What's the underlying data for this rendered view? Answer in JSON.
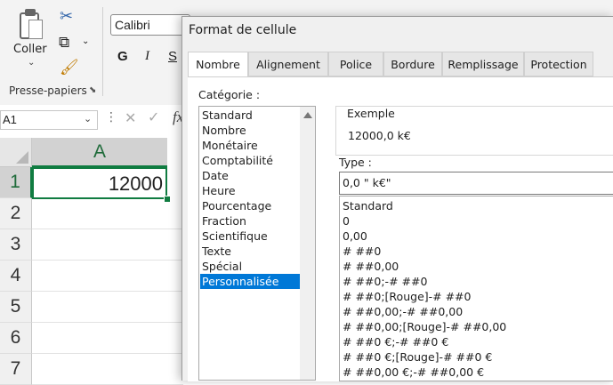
{
  "ribbon": {
    "paste_label": "Coller",
    "clipboard_group_label": "Presse-papiers",
    "font_name": "Calibri",
    "bold_label": "G",
    "italic_label": "I",
    "underline_label": "S"
  },
  "formula_bar": {
    "name_box": "A1",
    "fx_label": "fx"
  },
  "sheet": {
    "column_header": "A",
    "rows": [
      "1",
      "2",
      "3",
      "4",
      "5",
      "6",
      "7"
    ],
    "cell_a1": "12000"
  },
  "dialog": {
    "title": "Format de cellule",
    "tabs": [
      "Nombre",
      "Alignement",
      "Police",
      "Bordure",
      "Remplissage",
      "Protection"
    ],
    "active_tab": "Nombre",
    "category_label": "Catégorie :",
    "categories": [
      "Standard",
      "Nombre",
      "Monétaire",
      "Comptabilité",
      "Date",
      "Heure",
      "Pourcentage",
      "Fraction",
      "Scientifique",
      "Texte",
      "Spécial",
      "Personnalisée"
    ],
    "selected_category": "Personnalisée",
    "sample_label": "Exemple",
    "sample_value": "12000,0  k€",
    "type_label": "Type :",
    "type_value": "0,0 \" k€\"",
    "formats": [
      "Standard",
      "0",
      "0,00",
      "# ##0",
      "# ##0,00",
      "# ##0;-# ##0",
      "# ##0;[Rouge]-# ##0",
      "# ##0,00;-# ##0,00",
      "# ##0,00;[Rouge]-# ##0,00",
      "# ##0 €;-# ##0 €",
      "# ##0 €;[Rouge]-# ##0 €",
      "# ##0,00 €;-# ##0,00 €"
    ]
  },
  "colors": {
    "excel_green": "#107c41",
    "selection_blue": "#0078d7"
  }
}
